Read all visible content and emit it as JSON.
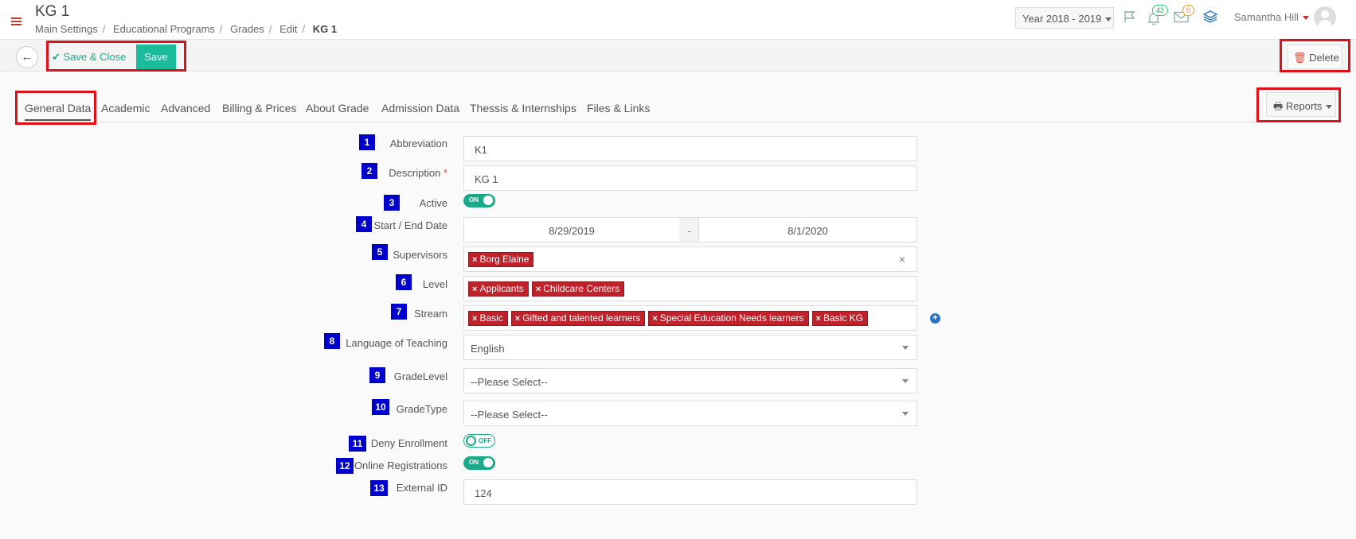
{
  "header": {
    "title": "KG 1",
    "breadcrumb": [
      "Main Settings",
      "Educational Programs",
      "Grades",
      "Edit",
      "KG 1"
    ],
    "year": "Year 2018 - 2019",
    "notifications_count": "42",
    "messages_count": "0",
    "user_name": "Samantha Hill"
  },
  "toolbar": {
    "save_close_label": "Save & Close",
    "save_label": "Save",
    "delete_label": "Delete"
  },
  "tabs": [
    {
      "label": "General Data",
      "active": true
    },
    {
      "label": "Academic"
    },
    {
      "label": "Advanced"
    },
    {
      "label": "Billing & Prices"
    },
    {
      "label": "About Grade"
    },
    {
      "label": "Admission Data"
    },
    {
      "label": "Thessis & Internships"
    },
    {
      "label": "Files & Links"
    }
  ],
  "reports_label": "Reports",
  "form": {
    "abbreviation": {
      "num": "1",
      "label": "Abbreviation",
      "value": "K1"
    },
    "description": {
      "num": "2",
      "label": "Description",
      "required_mark": "*",
      "value": "KG 1"
    },
    "active": {
      "num": "3",
      "label": "Active",
      "state": "ON"
    },
    "dates": {
      "num": "4",
      "label": "Start / End Date",
      "start": "8/29/2019",
      "separator": "-",
      "end": "8/1/2020"
    },
    "supervisors": {
      "num": "5",
      "label": "Supervisors",
      "tags": [
        "Borg Elaine"
      ],
      "clear": "×"
    },
    "level": {
      "num": "6",
      "label": "Level",
      "tags": [
        "Applicants",
        "Childcare Centers"
      ]
    },
    "stream": {
      "num": "7",
      "label": "Stream",
      "tags": [
        "Basic",
        "Gifted and talented learners",
        "Special Education Needs learners",
        "Basic KG"
      ]
    },
    "language": {
      "num": "8",
      "label": "Language of Teaching",
      "value": "English"
    },
    "grade_level": {
      "num": "9",
      "label": "GradeLevel",
      "value": "--Please Select--"
    },
    "grade_type": {
      "num": "10",
      "label": "GradeType",
      "value": "--Please Select--"
    },
    "deny_enrollment": {
      "num": "11",
      "label": "Deny Enrollment",
      "state": "OFF"
    },
    "online_registrations": {
      "num": "12",
      "label": "Online Registrations",
      "state": "ON"
    },
    "external_id": {
      "num": "13",
      "label": "External ID",
      "value": "124"
    }
  },
  "colors": {
    "accent": "#1abc9c",
    "tag": "#c0222c",
    "highlight": "#e0101a",
    "number_badge": "#0000cc"
  }
}
